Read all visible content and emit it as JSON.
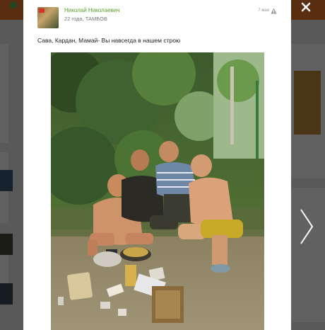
{
  "post": {
    "author_name": "Николай Николаевич",
    "author_meta": "22 года, ТАМБОВ",
    "time": "7 мая",
    "text": "Сава, Кардан, Мамай- Вы навсегда в нашем строю"
  },
  "icons": {
    "close": "close-icon",
    "next": "chevron-right-icon",
    "warning": "warning-icon"
  },
  "colors": {
    "author": "#5aa02c",
    "topbar": "#e8782a"
  }
}
